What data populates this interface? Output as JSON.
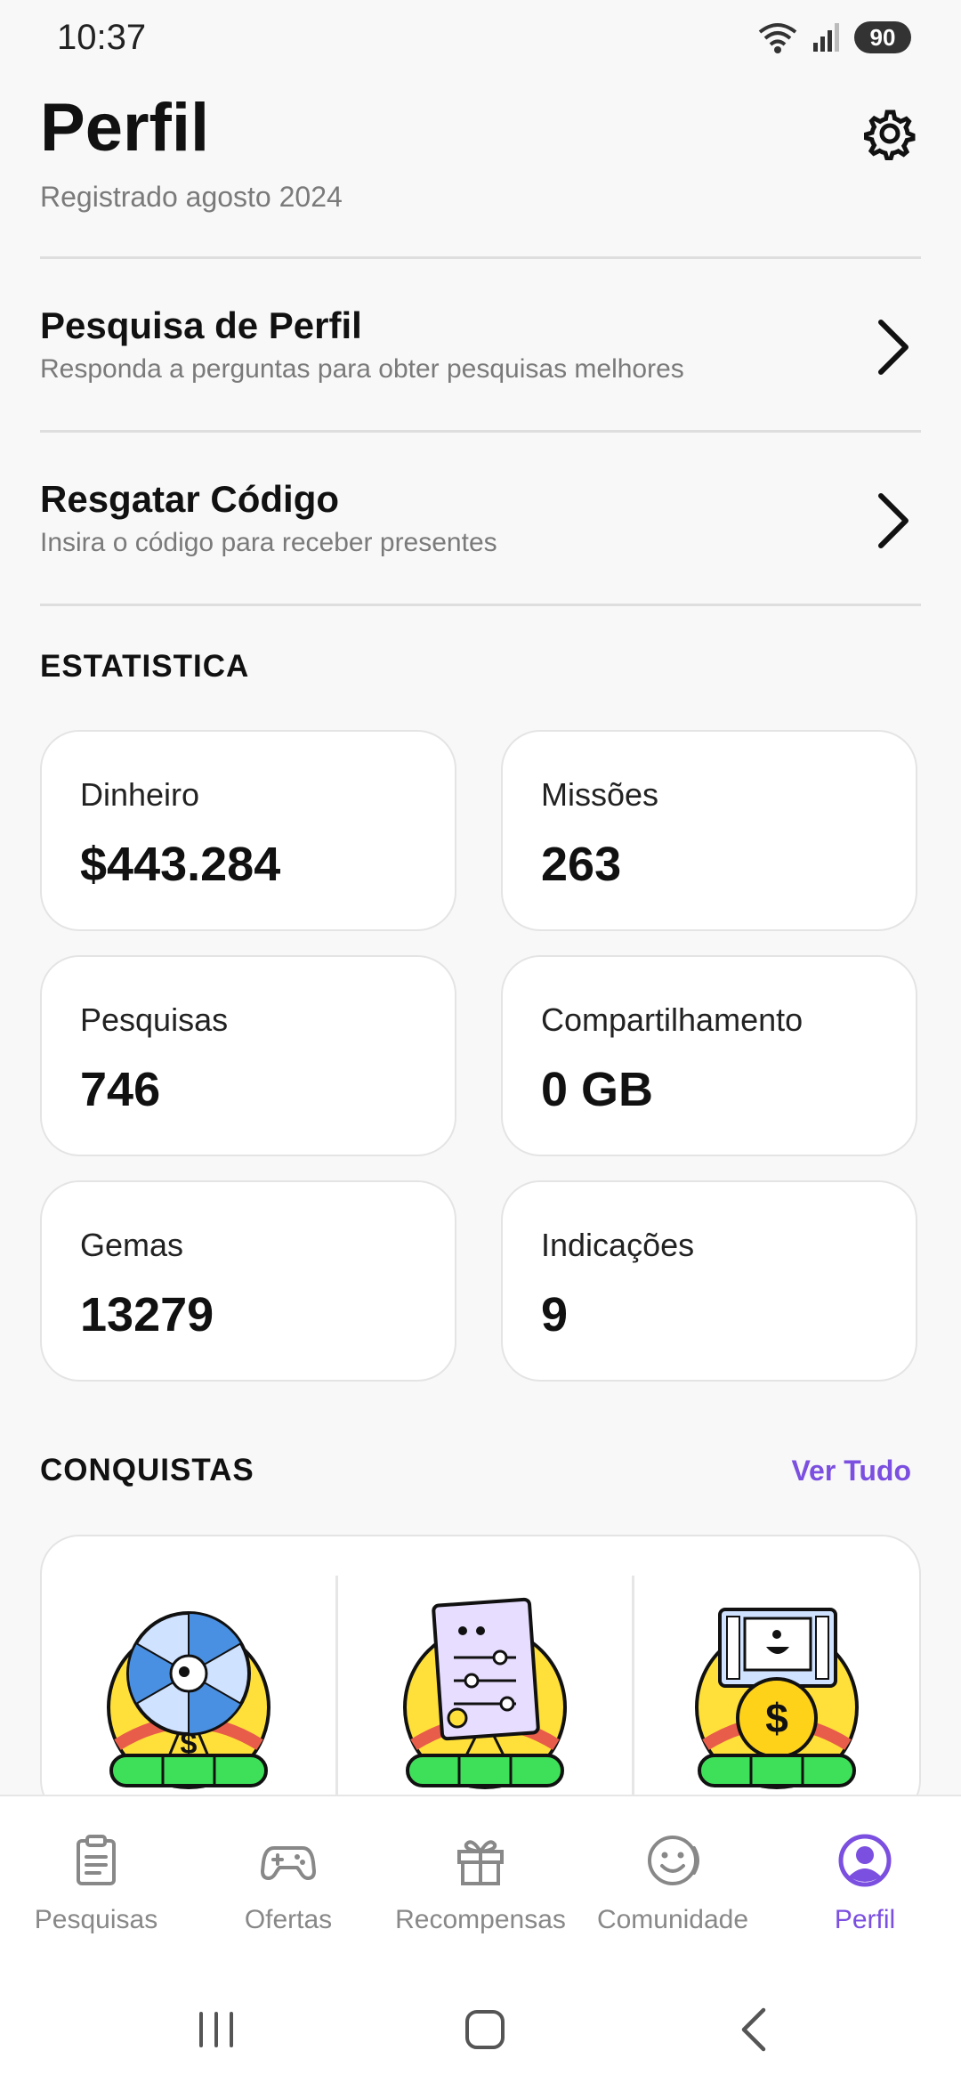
{
  "status_bar": {
    "time": "10:37",
    "battery": "90"
  },
  "header": {
    "title": "Perfil"
  },
  "profile": {
    "registered": "Registrado agosto 2024"
  },
  "menu": [
    {
      "title": "Pesquisa de Perfil",
      "subtitle": "Responda a perguntas para obter pesquisas melhores"
    },
    {
      "title": "Resgatar Código",
      "subtitle": "Insira o código para receber presentes"
    }
  ],
  "stats": {
    "section_label": "ESTATISTICA",
    "items": [
      {
        "label": "Dinheiro",
        "value": "$443.284"
      },
      {
        "label": "Missões",
        "value": "263"
      },
      {
        "label": "Pesquisas",
        "value": "746"
      },
      {
        "label": "Compartilhamento",
        "value": "0 GB"
      },
      {
        "label": "Gemas",
        "value": "13279"
      },
      {
        "label": "Indicações",
        "value": "9"
      }
    ]
  },
  "achievements": {
    "section_label": "CONQUISTAS",
    "see_all": "Ver Tudo",
    "badges": [
      {
        "icon": "spin-wheel-badge-icon"
      },
      {
        "icon": "survey-sheet-badge-icon"
      },
      {
        "icon": "video-coin-badge-icon"
      }
    ]
  },
  "bottom_nav": {
    "items": [
      {
        "label": "Pesquisas",
        "icon": "clipboard-icon"
      },
      {
        "label": "Ofertas",
        "icon": "gamepad-icon"
      },
      {
        "label": "Recompensas",
        "icon": "gift-icon"
      },
      {
        "label": "Comunidade",
        "icon": "smiley-icon"
      },
      {
        "label": "Perfil",
        "icon": "profile-icon",
        "active": true
      }
    ]
  },
  "colors": {
    "accent": "#7b4fe0",
    "badge_yellow": "#ffe03a",
    "badge_green": "#3ee05a"
  }
}
